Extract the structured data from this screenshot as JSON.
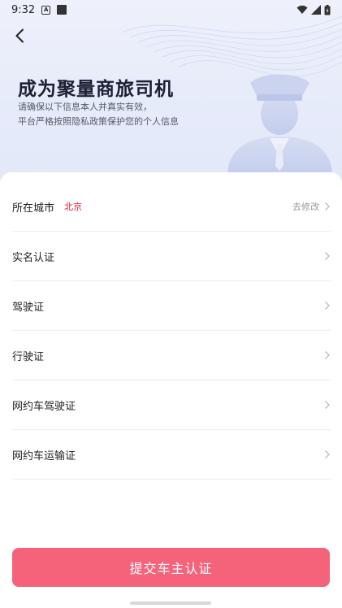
{
  "status_bar": {
    "time": "9:32",
    "a_badge": "A"
  },
  "header": {
    "title": "成为聚量商旅司机",
    "subtitle_line1": "请确保以下信息本人并真实有效，",
    "subtitle_line2": "平台严格按照隐私政策保护您的个人信息"
  },
  "rows": [
    {
      "label": "所在城市",
      "value": "北京",
      "action": "去修改"
    },
    {
      "label": "实名认证"
    },
    {
      "label": "驾驶证"
    },
    {
      "label": "行驶证"
    },
    {
      "label": "网约车驾驶证"
    },
    {
      "label": "网约车运输证"
    }
  ],
  "submit_label": "提交车主认证",
  "colors": {
    "accent": "#f4637a",
    "city": "#e0203a",
    "hero_bg": "#e6ebfa"
  }
}
